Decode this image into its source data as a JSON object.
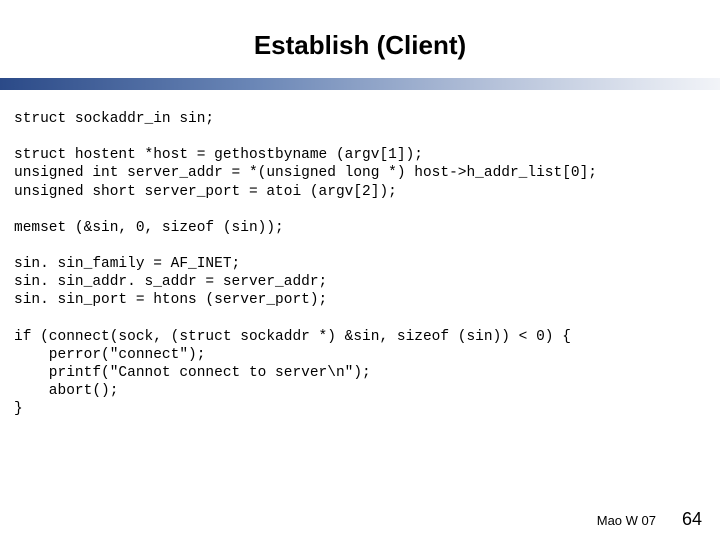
{
  "slide": {
    "title": "Establish (Client)",
    "code": "struct sockaddr_in sin;\n\nstruct hostent *host = gethostbyname (argv[1]);\nunsigned int server_addr = *(unsigned long *) host->h_addr_list[0];\nunsigned short server_port = atoi (argv[2]);\n\nmemset (&sin, 0, sizeof (sin));\n\nsin. sin_family = AF_INET;\nsin. sin_addr. s_addr = server_addr;\nsin. sin_port = htons (server_port);\n\nif (connect(sock, (struct sockaddr *) &sin, sizeof (sin)) < 0) {\n    perror(\"connect\");\n    printf(\"Cannot connect to server\\n\");\n    abort();\n}",
    "footer_credit": "Mao W 07",
    "page_number": "64"
  }
}
